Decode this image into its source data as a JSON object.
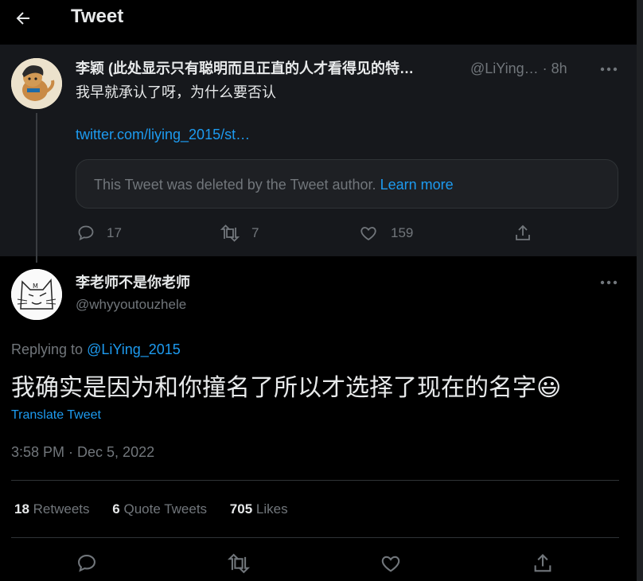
{
  "header": {
    "title": "Tweet"
  },
  "parent_tweet": {
    "name": "李颖 (此处显示只有聪明而且正直的人才看得见的特…",
    "handle": "@LiYing…",
    "separator": "·",
    "time": "8h",
    "text": "我早就承认了呀，为什么要否认",
    "link": "twitter.com/liying_2015/st…",
    "deleted_notice": "This Tweet was deleted by the Tweet author.",
    "learn_more": "Learn more",
    "reply_count": "17",
    "retweet_count": "7",
    "like_count": "159"
  },
  "tweet": {
    "name": "李老师不是你老师",
    "handle": "@whyyoutouzhele",
    "replying_prefix": "Replying to",
    "replying_to": "@LiYing_2015",
    "text": "我确实是因为和你撞名了所以才选择了现在的名字😃",
    "translate": "Translate Tweet",
    "timestamp": "3:58 PM · Dec 5, 2022"
  },
  "stats": {
    "retweets": "18",
    "retweets_label": "Retweets",
    "quotes": "6",
    "quotes_label": "Quote Tweets",
    "likes": "705",
    "likes_label": "Likes"
  },
  "icons": {
    "back": "arrow-left-icon",
    "reply": "reply-icon",
    "retweet": "retweet-icon",
    "like": "heart-icon",
    "share": "share-icon",
    "more": "more-icon"
  },
  "colors": {
    "accent": "#1d9bf0",
    "muted": "#71767b",
    "text": "#e7e9ea"
  }
}
